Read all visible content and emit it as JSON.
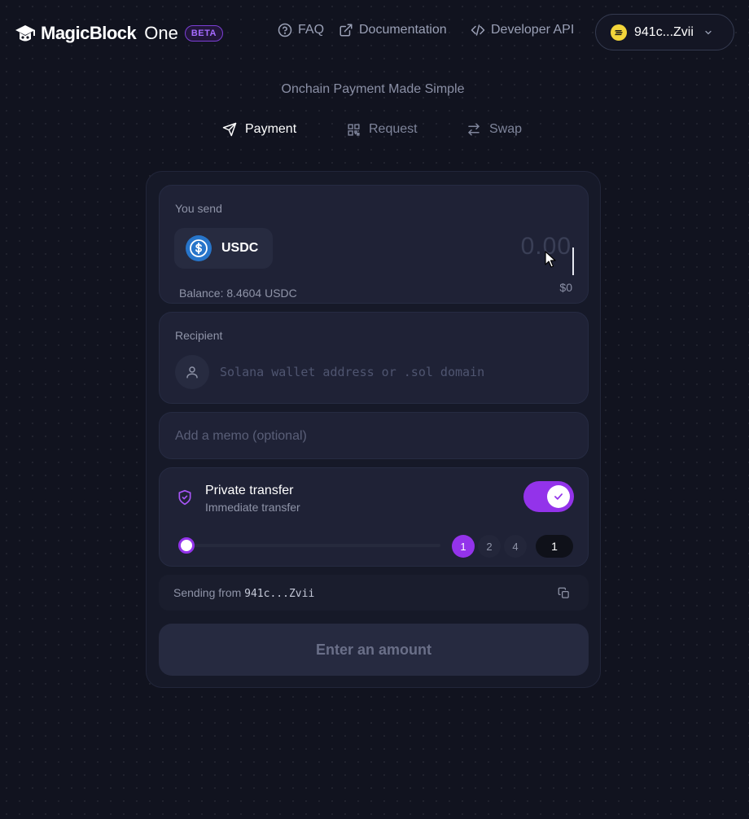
{
  "header": {
    "brand_name": "MagicBlock",
    "brand_suffix": "One",
    "beta_badge": "BETA",
    "nav": [
      {
        "label": "FAQ",
        "icon": "help-circle-icon"
      },
      {
        "label": "Documentation",
        "icon": "external-link-icon"
      },
      {
        "label": "Developer API",
        "icon": "code-icon"
      }
    ],
    "wallet": {
      "label": "941c...Zvii",
      "icon": "solana-coin-icon"
    }
  },
  "tagline": "Onchain Payment Made Simple",
  "tabs": [
    {
      "label": "Payment",
      "icon": "send-icon",
      "active": true
    },
    {
      "label": "Request",
      "icon": "qr-code-icon",
      "active": false
    },
    {
      "label": "Swap",
      "icon": "swap-arrows-icon",
      "active": false
    }
  ],
  "send": {
    "label": "You send",
    "token": "USDC",
    "amount_placeholder": "0.00",
    "usd_value": "$0",
    "balance": "Balance: 8.4604 USDC"
  },
  "recipient": {
    "label": "Recipient",
    "placeholder": "Solana wallet address or .sol domain"
  },
  "memo": {
    "placeholder": "Add a memo (optional)"
  },
  "private_transfer": {
    "title": "Private transfer",
    "subtitle": "Immediate transfer",
    "enabled": true,
    "split_options": [
      "1",
      "2",
      "4"
    ],
    "selected_split": "1",
    "count": "1"
  },
  "sending_from": {
    "prefix": "Sending from",
    "address": "941c...Zvii"
  },
  "cta": {
    "label": "Enter an amount"
  },
  "colors": {
    "accent": "#9333ea",
    "background": "#11131f",
    "usdc": "#2775ca",
    "wallet_coin": "#f3d53a"
  }
}
